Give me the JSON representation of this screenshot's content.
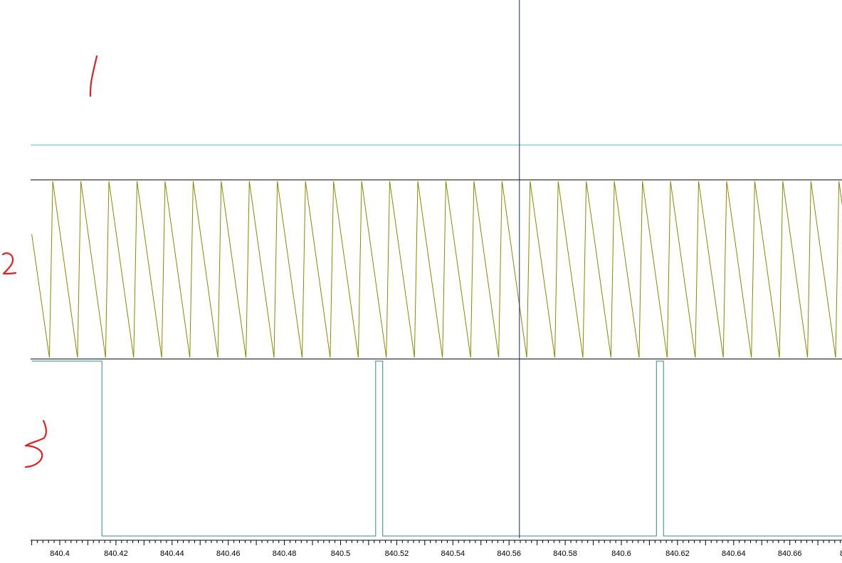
{
  "chart_data": {
    "type": "line",
    "title": "",
    "xlabel": "",
    "ylabel": "",
    "grid": false,
    "legend": "none",
    "xlim": [
      840.39,
      840.68
    ],
    "x_ticks": {
      "values": [
        840.4,
        840.42,
        840.44,
        840.46,
        840.48,
        840.5,
        840.52,
        840.54,
        840.56,
        840.58,
        840.6,
        840.62,
        840.64,
        840.66
      ],
      "labels": [
        "840.4",
        "840.42",
        "840.44",
        "840.46",
        "840.48",
        "840.5",
        "840.52",
        "840.54",
        "840.56",
        "840.58",
        "840.6",
        "840.62",
        "840.64",
        "840.66"
      ],
      "edge_label": "8"
    },
    "cursor_x": 840.5637,
    "panels": [
      {
        "id": "1",
        "annotation": "1",
        "series": [
          {
            "kind": "constant",
            "level": 1.0,
            "color": "#4fc3c0"
          }
        ]
      },
      {
        "id": "2",
        "annotation": "2",
        "series": [
          {
            "kind": "sawtooth",
            "color": "#8a8a00",
            "min": 0,
            "max": 1,
            "period": 0.01,
            "first_peak_x": 840.3975,
            "fall_fraction": 0.88,
            "start_level": 0.7
          }
        ]
      },
      {
        "id": "3",
        "annotation": "3",
        "series": [
          {
            "kind": "pulse",
            "color": "#2e8b8b",
            "low": 0,
            "high": 1,
            "high_intervals": [
              [
                840.39,
                840.415
              ],
              [
                840.5125,
                840.515
              ],
              [
                840.6125,
                840.615
              ]
            ]
          }
        ]
      }
    ]
  },
  "colors": {
    "background": "#ffffff",
    "panel_border": "#000000",
    "cursor": "#1a237e",
    "annotation": "#e02020",
    "channel_1": "#4fc3c0",
    "channel_2": "#8a8a00",
    "channel_3": "#2e8b8b"
  }
}
